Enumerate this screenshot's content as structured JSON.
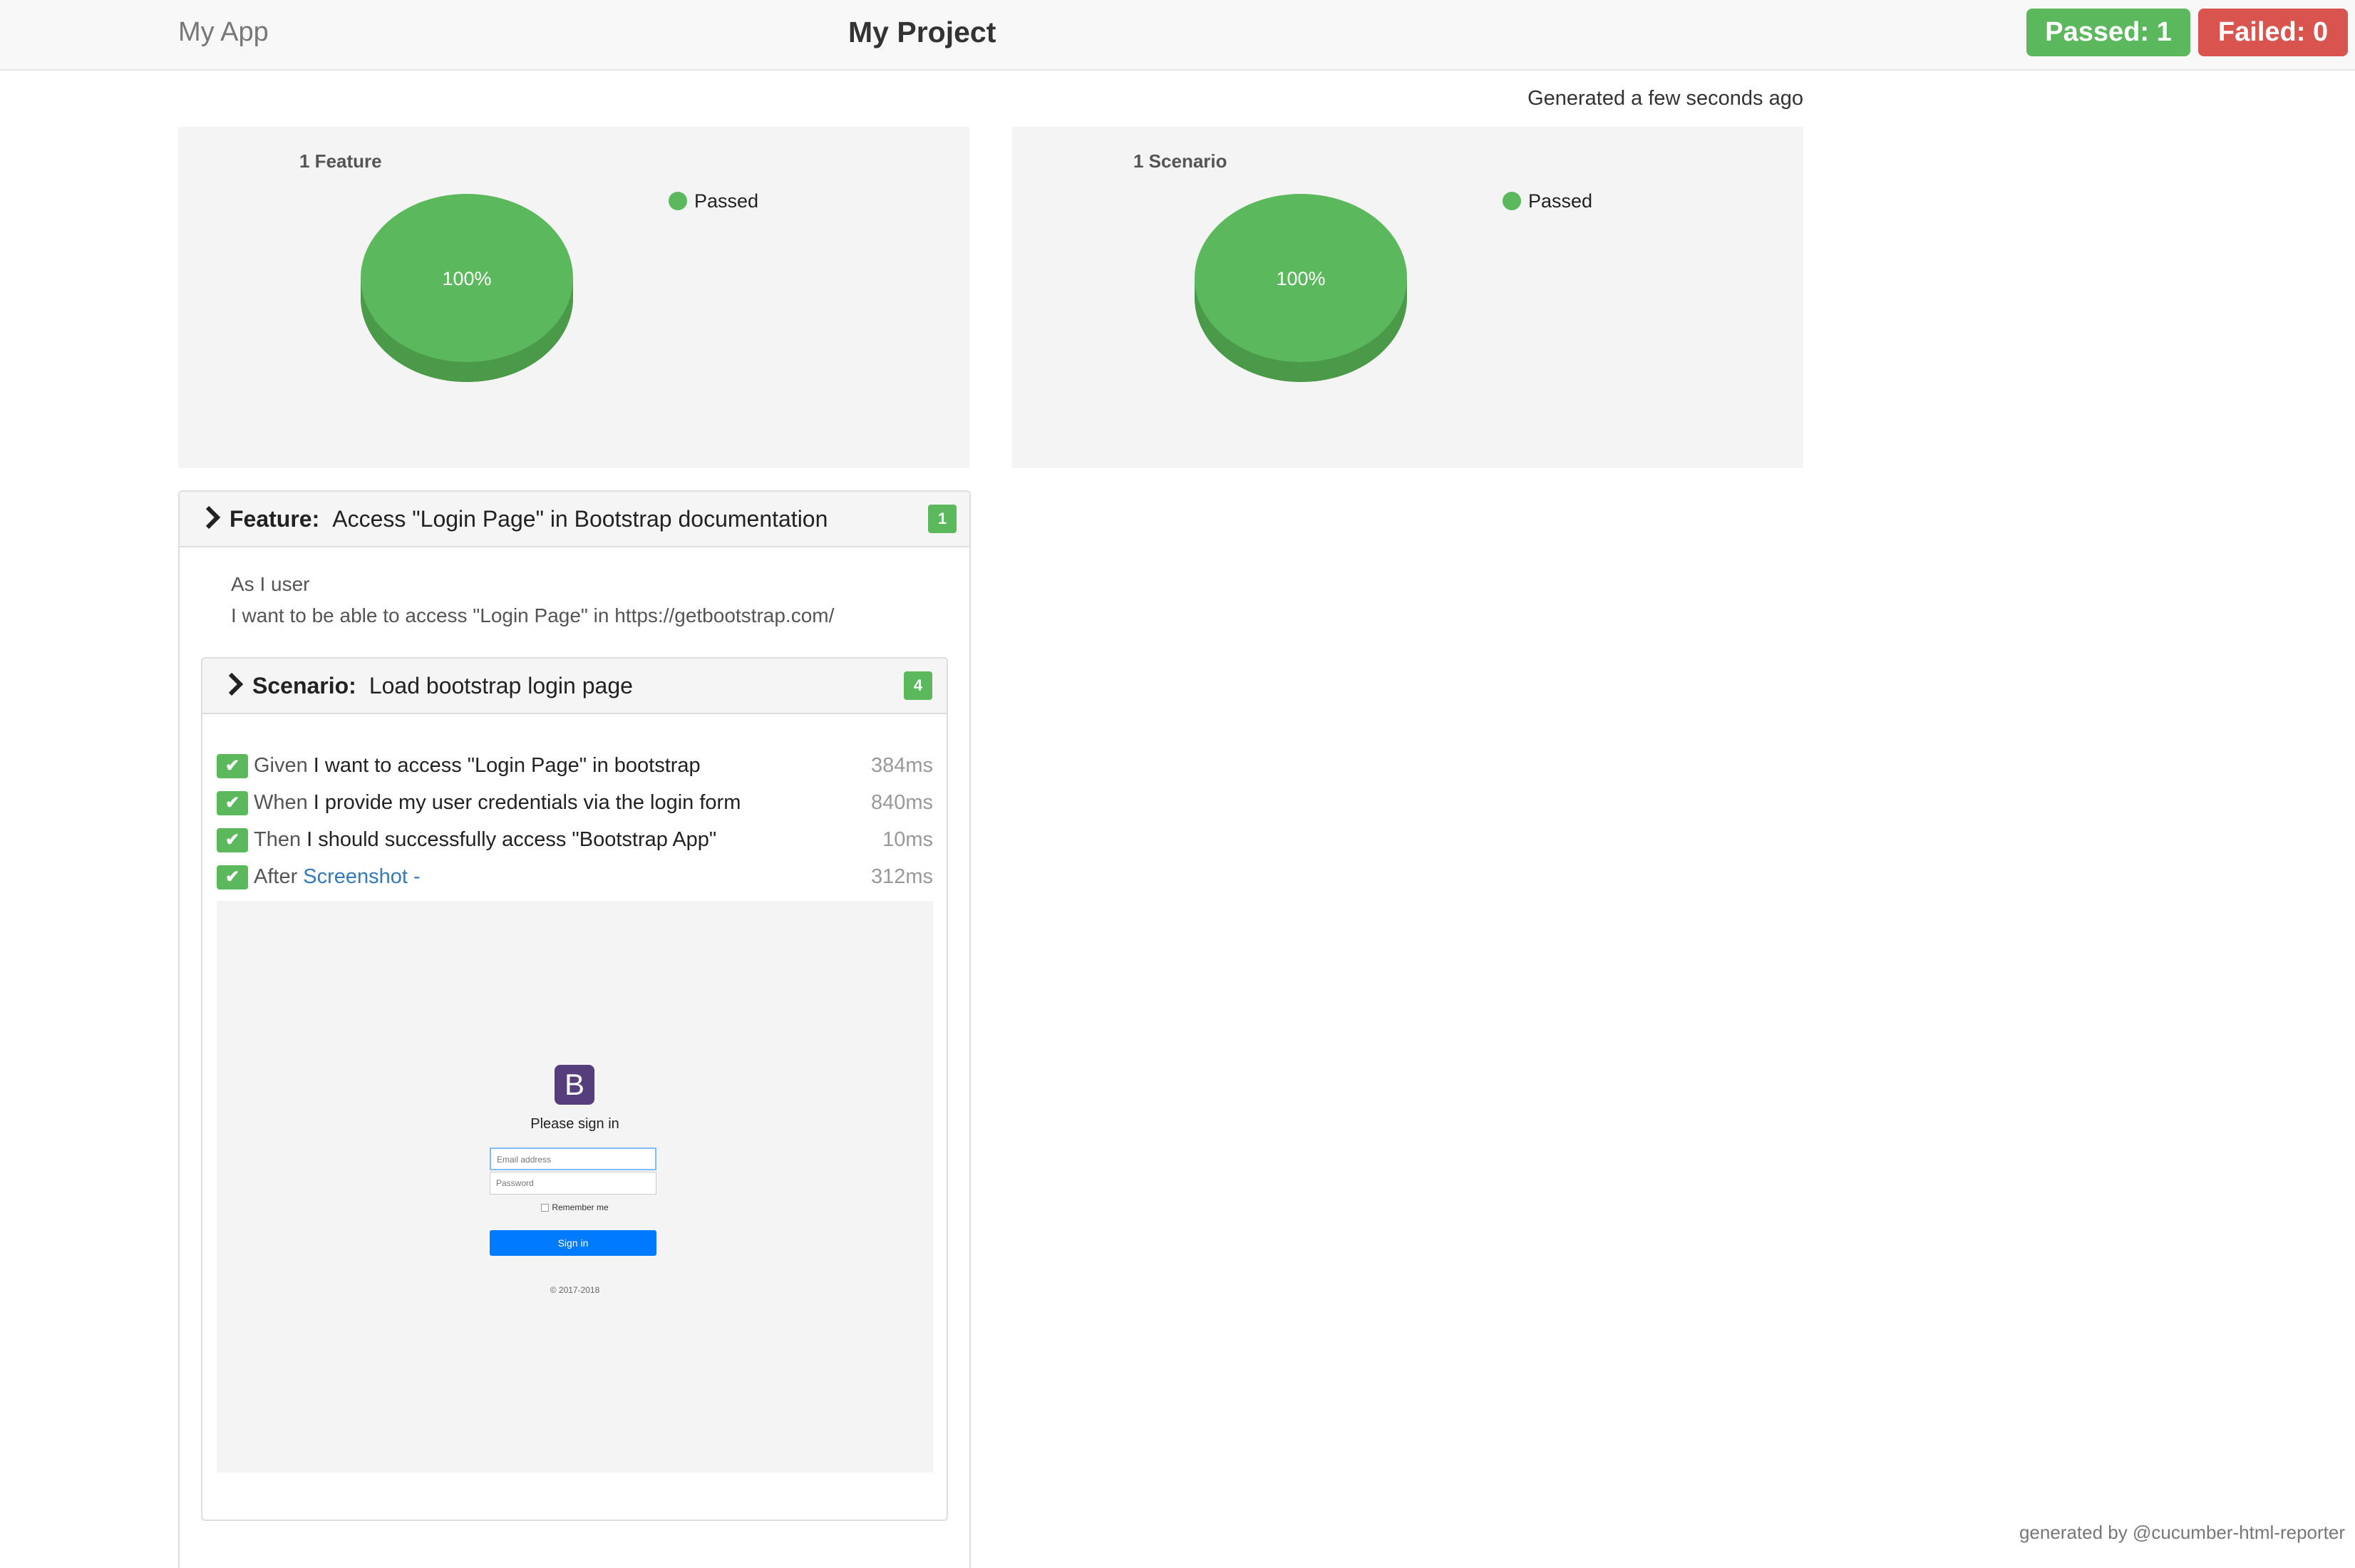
{
  "navbar": {
    "app_name": "My App",
    "project_title": "My Project",
    "passed_label": "Passed: 1",
    "failed_label": "Failed: 0"
  },
  "generated_text": "Generated a few seconds ago",
  "charts": {
    "features": {
      "title": "1 Feature",
      "legend": "Passed",
      "percent_label": "100%"
    },
    "scenarios": {
      "title": "1 Scenario",
      "legend": "Passed",
      "percent_label": "100%"
    }
  },
  "chart_data": [
    {
      "type": "pie",
      "title": "1 Feature",
      "categories": [
        "Passed"
      ],
      "values": [
        100
      ],
      "legend_placement": "top-right"
    },
    {
      "type": "pie",
      "title": "1 Scenario",
      "categories": [
        "Passed"
      ],
      "values": [
        100
      ],
      "legend_placement": "top-right"
    }
  ],
  "feature": {
    "keyword": "Feature:",
    "name": "Access \"Login Page\" in Bootstrap documentation",
    "count": "1",
    "description": [
      "As I user",
      "I want to be able to access \"Login Page\" in https://getbootstrap.com/"
    ]
  },
  "scenario": {
    "keyword": "Scenario:",
    "name": "Load bootstrap login page",
    "count": "4",
    "steps": [
      {
        "keyword": "Given",
        "text": "I want to access \"Login Page\" in bootstrap",
        "duration": "384ms"
      },
      {
        "keyword": "When",
        "text": "I provide my user credentials via the login form",
        "duration": "840ms"
      },
      {
        "keyword": "Then",
        "text": "I should successfully access \"Bootstrap App\"",
        "duration": "10ms"
      },
      {
        "keyword": "After",
        "text": "Screenshot -",
        "duration": "312ms"
      }
    ]
  },
  "embedded_screenshot": {
    "logo_letter": "B",
    "heading": "Please sign in",
    "email_placeholder": "Email address",
    "password_placeholder": "Password",
    "remember_label": "Remember me",
    "signin_label": "Sign in",
    "copyright": "© 2017-2018"
  },
  "footer": "generated by @cucumber-html-reporter",
  "colors": {
    "passed": "#5cb85c",
    "failed": "#d9534f",
    "link": "#337ab7",
    "bootstrap_purple": "#563d7c",
    "primary": "#007bff"
  },
  "icons": {
    "expand": "chevron-right-icon",
    "step_status": "check-icon"
  }
}
